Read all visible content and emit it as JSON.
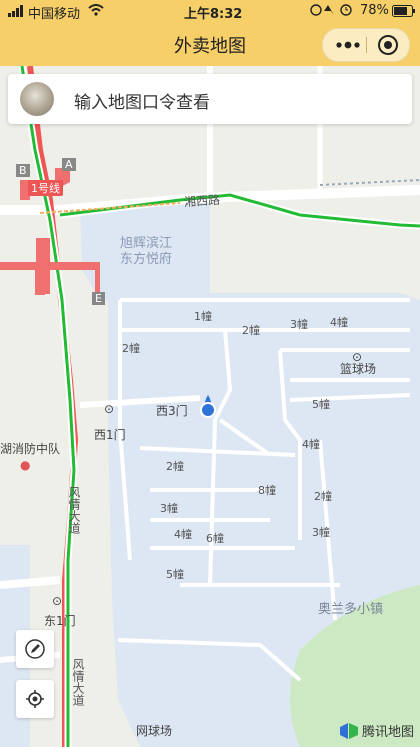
{
  "status": {
    "carrier": "中国移动",
    "time": "上午8:32",
    "battery": "78%"
  },
  "nav": {
    "title": "外卖地图"
  },
  "search": {
    "placeholder": "输入地图口令查看"
  },
  "map": {
    "metro_line": "1号线",
    "metro_exits": [
      "A",
      "B",
      "E"
    ],
    "roads": [
      "湘西路",
      "风情大道",
      "风情大道"
    ],
    "community": "旭辉滨江东方悦府",
    "community_line1": "旭辉滨江",
    "community_line2": "东方悦府",
    "gates": [
      "西3门",
      "西1门",
      "东1门"
    ],
    "buildings": [
      "1幢",
      "2幢",
      "3幢",
      "4幢",
      "2幢",
      "5幢",
      "4幢",
      "2幢",
      "8幢",
      "2幢",
      "3幢",
      "4幢",
      "6幢",
      "3幢",
      "5幢"
    ],
    "basketball": "篮球场",
    "tennis": "网球场",
    "town": "奥兰多小镇",
    "fire_station": "湖消防中队",
    "provider": "腾讯地图"
  },
  "icons": {
    "edit": "pencil-icon",
    "locate": "locate-icon",
    "menu": "more-dots-icon",
    "target": "target-icon",
    "wifi": "wifi-icon",
    "battery": "battery-icon"
  },
  "colors": {
    "header": "#f6cf68",
    "community_area": "#dde7f3",
    "road_green": "#22bb33",
    "road_red": "#ee5555",
    "park": "#cde9c3"
  }
}
